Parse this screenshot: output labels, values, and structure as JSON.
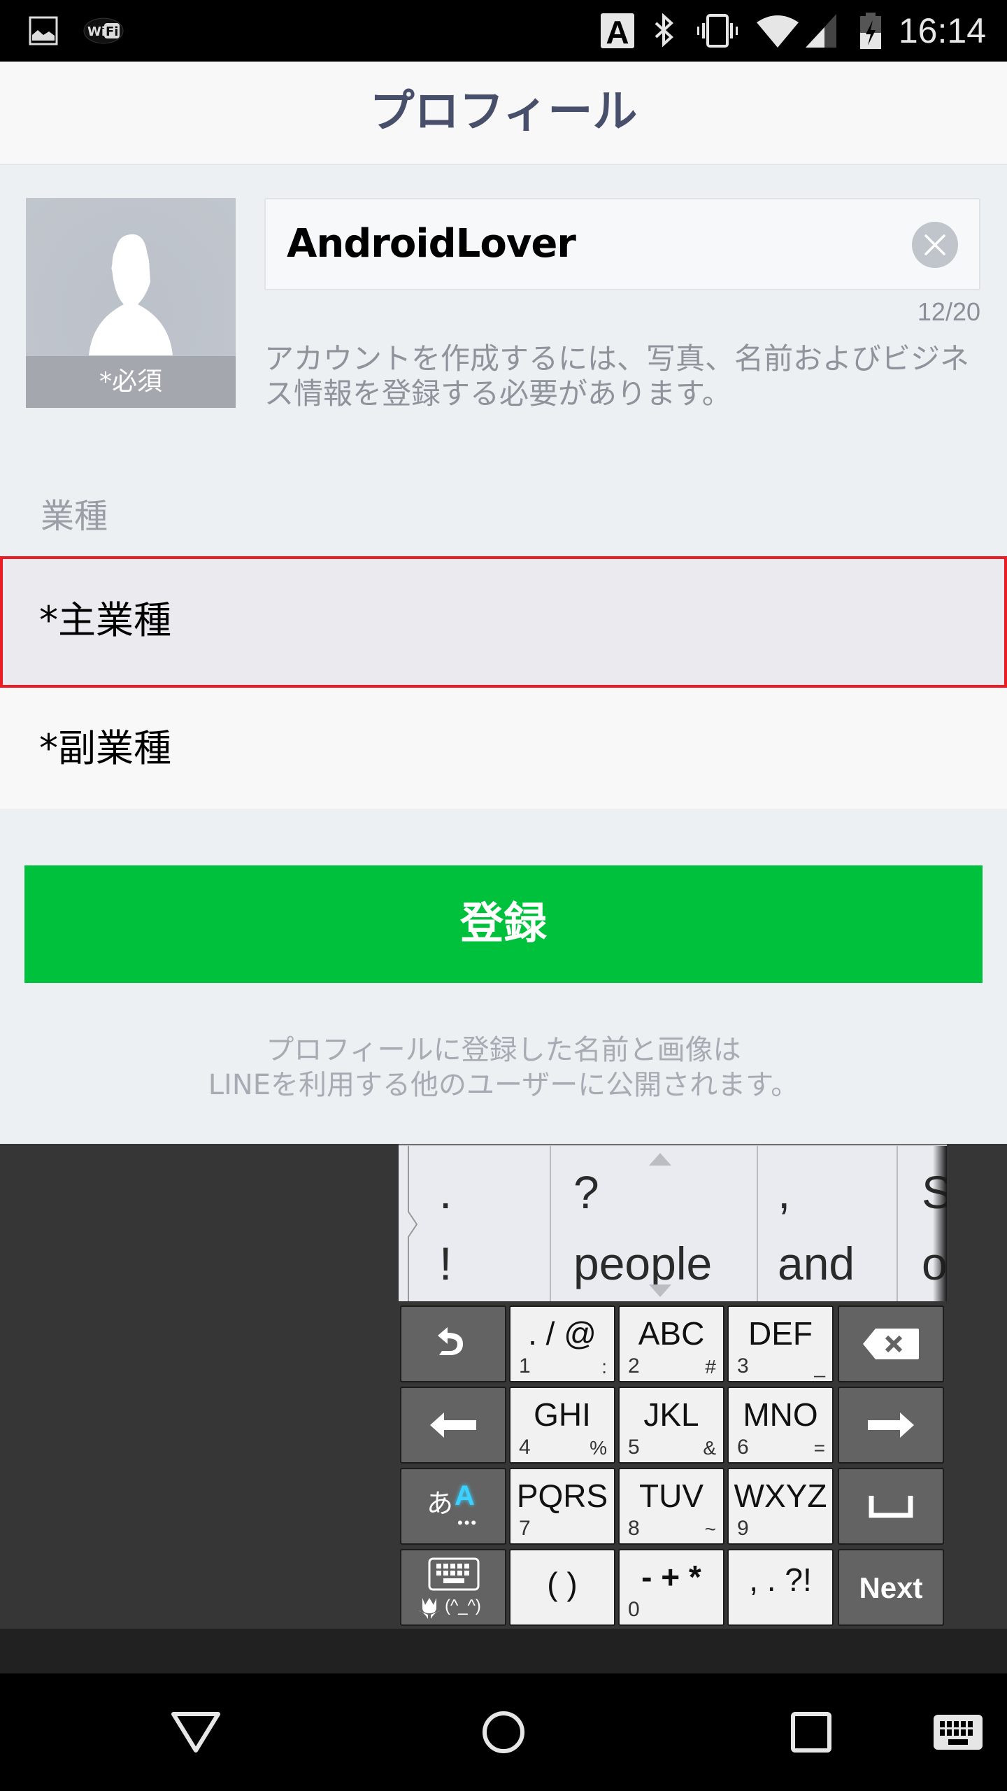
{
  "status_bar": {
    "left_icons": [
      "image-icon",
      "wifi-hotspot-icon"
    ],
    "right_icons": [
      "input-method-a-icon",
      "bluetooth-icon",
      "vibrate-icon",
      "wifi-signal-icon",
      "cell-signal-icon",
      "battery-charging-icon"
    ],
    "time": "16:14"
  },
  "header": {
    "title": "プロフィール"
  },
  "profile": {
    "avatar_label": "*必須",
    "name_value": "AndroidLover",
    "char_count": "12/20",
    "help_text": "アカウントを作成するには、写真、名前およびビジネス情報を登録する必要があります。"
  },
  "industry": {
    "section_label": "業種",
    "main_label": "*主業種",
    "sub_label": "*副業種"
  },
  "register_button": {
    "label": "登録",
    "color": "#00c13b"
  },
  "footer_note": {
    "line1": "プロフィールに登録した名前と画像は",
    "line2": "LINEを利用する他のユーザーに公開されます。"
  },
  "highlight_color": "#ec1c24",
  "keyboard": {
    "suggestions": [
      {
        "top": ".",
        "bottom": "!"
      },
      {
        "top": "?",
        "bottom": "people"
      },
      {
        "top": ",",
        "bottom": "and"
      },
      {
        "top": "S",
        "bottom": "o"
      }
    ],
    "rows": [
      [
        {
          "type": "dark",
          "icon": "undo-icon"
        },
        {
          "type": "light",
          "main": ". / @",
          "num": "1",
          "alt": ":"
        },
        {
          "type": "light",
          "main": "ABC",
          "num": "2",
          "alt": "#"
        },
        {
          "type": "light",
          "main": "DEF",
          "num": "3",
          "alt": "_"
        },
        {
          "type": "dark",
          "icon": "backspace-icon"
        }
      ],
      [
        {
          "type": "dark",
          "icon": "arrow-left-icon"
        },
        {
          "type": "light",
          "main": "GHI",
          "num": "4",
          "alt": "%"
        },
        {
          "type": "light",
          "main": "JKL",
          "num": "5",
          "alt": "&"
        },
        {
          "type": "light",
          "main": "MNO",
          "num": "6",
          "alt": "="
        },
        {
          "type": "dark",
          "icon": "arrow-right-icon"
        }
      ],
      [
        {
          "type": "dark",
          "icon": "input-mode-icon",
          "label_kana": "あ",
          "label_latin": "A",
          "dots": "•••"
        },
        {
          "type": "light",
          "main": "PQRS",
          "num": "7",
          "alt": ""
        },
        {
          "type": "light",
          "main": "TUV",
          "num": "8",
          "alt": "~"
        },
        {
          "type": "light",
          "main": "WXYZ",
          "num": "9",
          "alt": ""
        },
        {
          "type": "dark",
          "icon": "space-icon"
        }
      ],
      [
        {
          "type": "dark",
          "icon": "keyboard-emoji-icon",
          "emoticon": "(^_^)"
        },
        {
          "type": "light",
          "main": "( )",
          "num": "",
          "alt": ""
        },
        {
          "type": "light",
          "main": "- + *",
          "num": "0",
          "alt": ""
        },
        {
          "type": "light",
          "main": ", . ?!",
          "num": "",
          "alt": ""
        },
        {
          "type": "dark",
          "main": "Next"
        }
      ]
    ]
  },
  "nav_bar": {
    "buttons": [
      "back-icon",
      "home-icon",
      "recents-icon",
      "keyboard-switch-icon"
    ]
  }
}
